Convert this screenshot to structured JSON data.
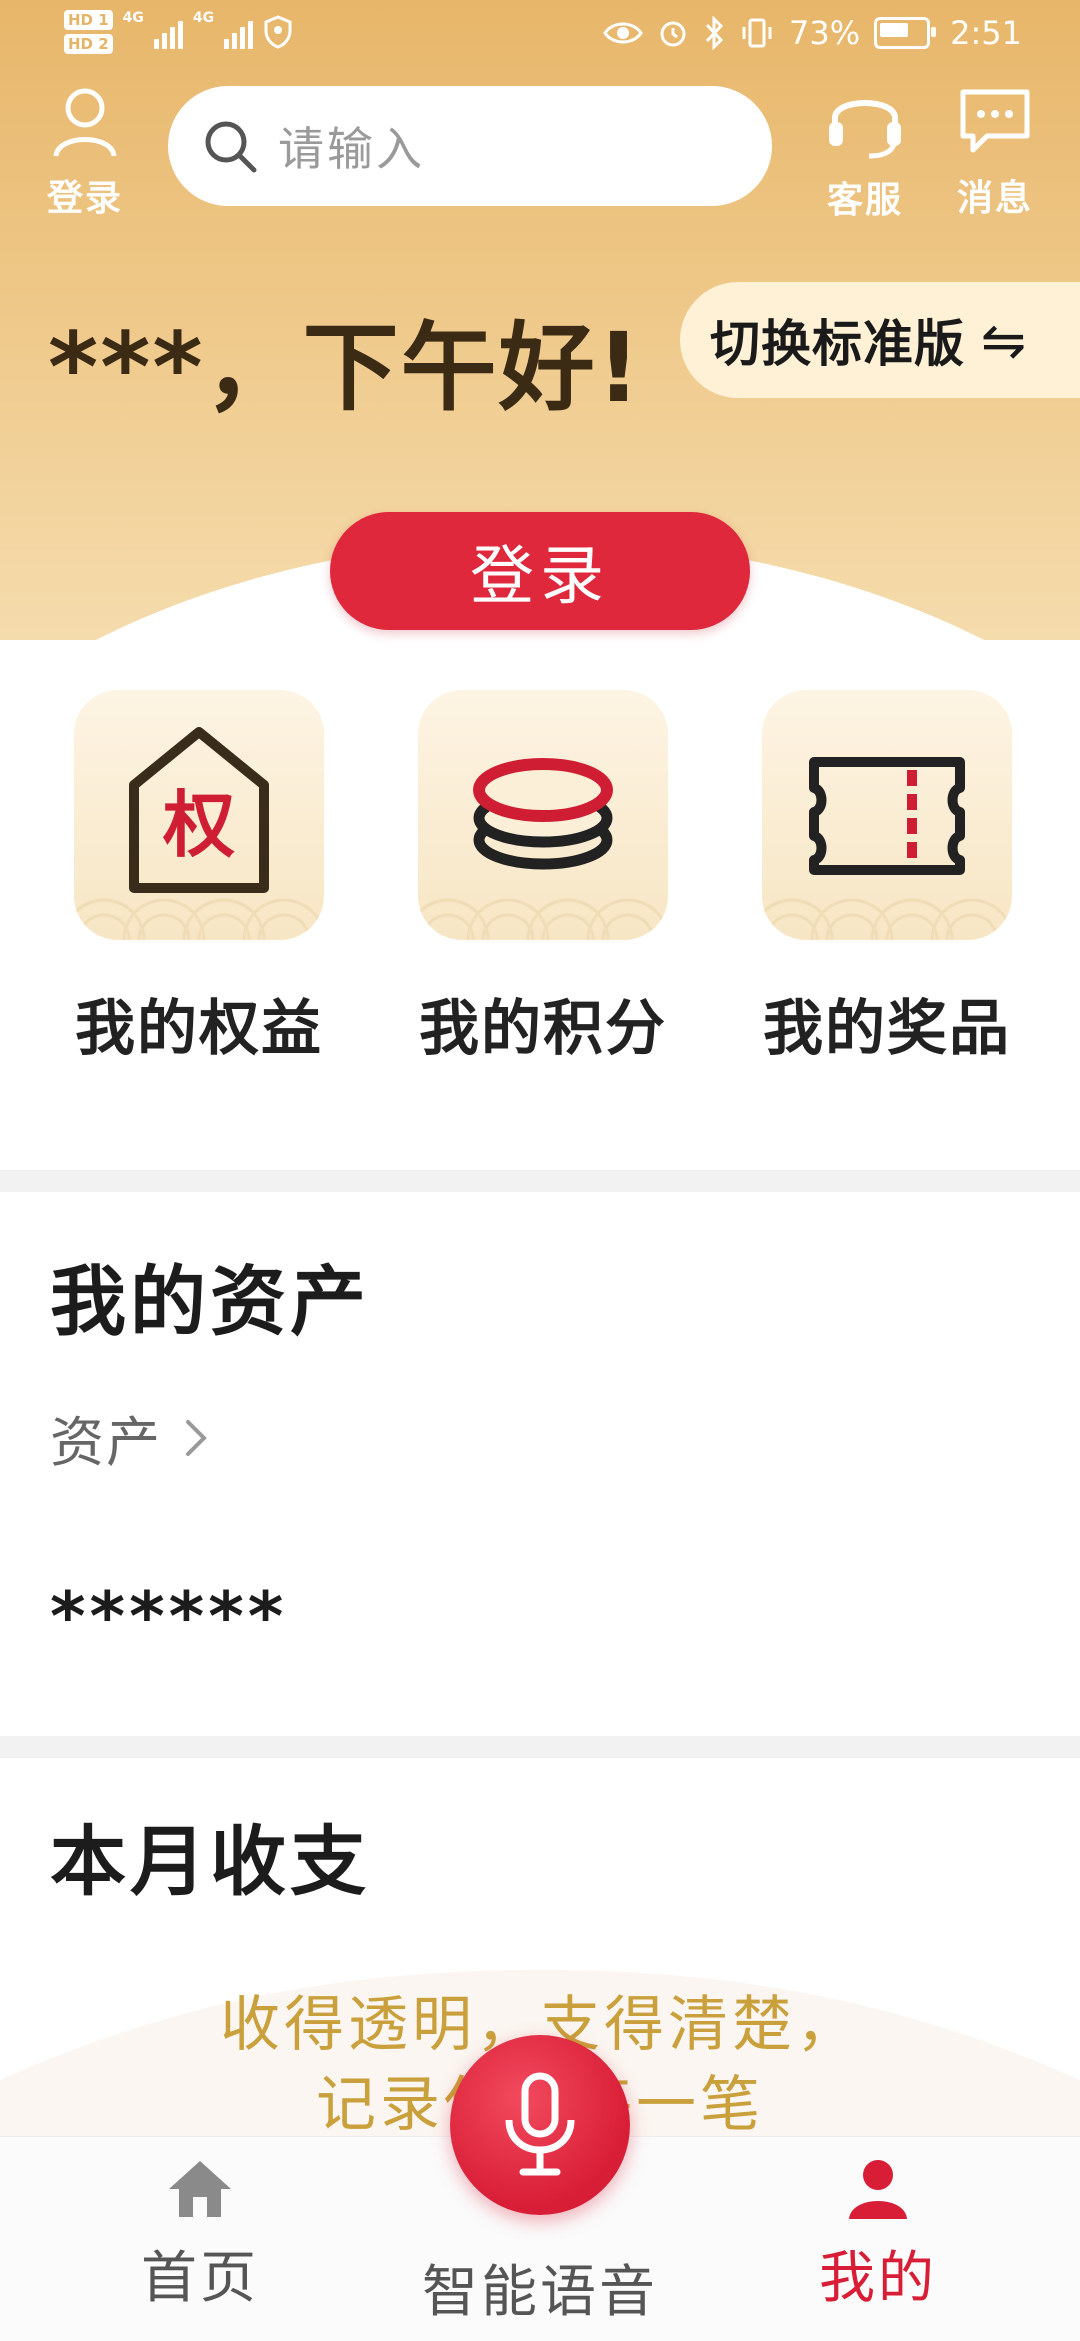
{
  "status_bar": {
    "hd1": "HD 1",
    "hd2": "HD 2",
    "net1": "4G",
    "net2": "4G",
    "battery_percent": "73%",
    "time": "2:51"
  },
  "toolbar": {
    "login_label": "登录",
    "search_placeholder": "请输入",
    "service_label": "客服",
    "message_label": "消息"
  },
  "greeting": "***，下午好!",
  "switch_label": "切换标准版",
  "switch_icon": "⇋",
  "login_button": "登录",
  "features": [
    {
      "label": "我的权益",
      "icon": "house-rights-icon",
      "glyph": "权"
    },
    {
      "label": "我的积分",
      "icon": "coins-icon"
    },
    {
      "label": "我的奖品",
      "icon": "ticket-icon"
    }
  ],
  "assets": {
    "title": "我的资产",
    "link_label": "资产",
    "value": "******"
  },
  "monthly": {
    "title": "本月收支",
    "slogan_line1": "收得透明，支得清楚，",
    "slogan_line2": "记录你的每一笔"
  },
  "bottom_nav": {
    "home_label": "首页",
    "voice_label": "智能语音",
    "mine_label": "我的"
  },
  "colors": {
    "accent_red": "#e0283d",
    "header_gold": "#e7b66a",
    "slogan_gold": "#c9a03b"
  }
}
